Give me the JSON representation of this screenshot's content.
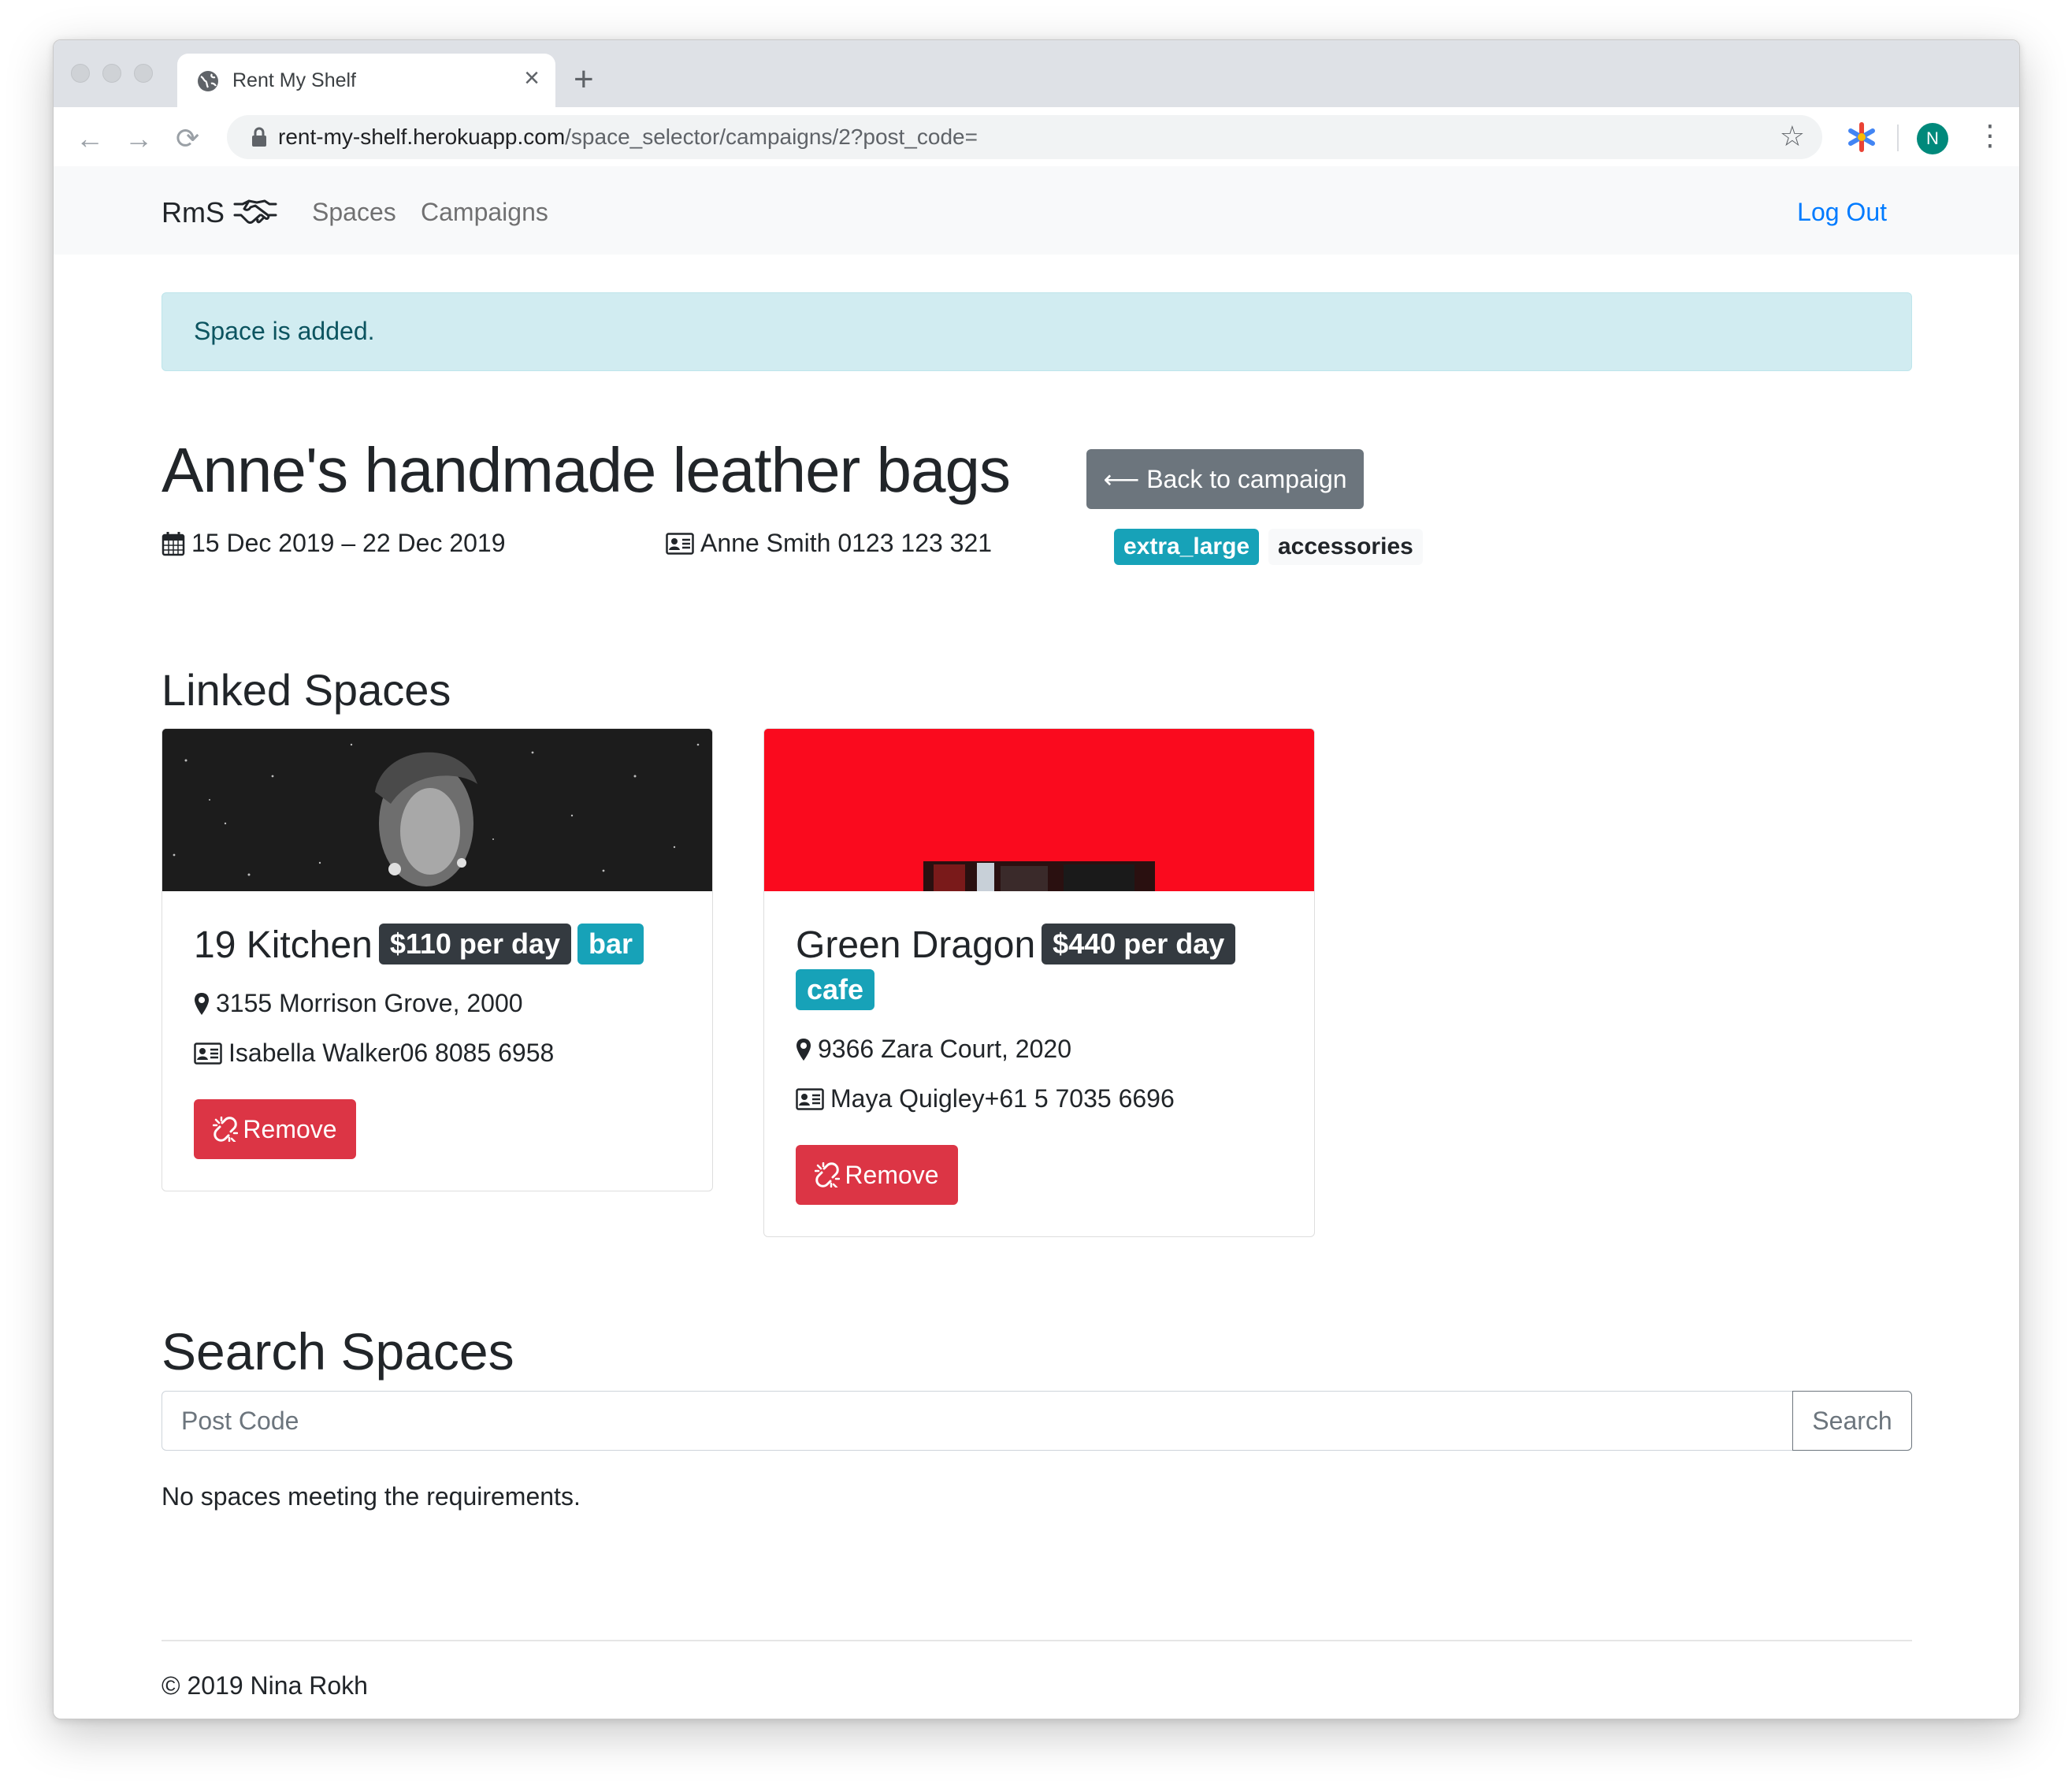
{
  "browser": {
    "tab_title": "Rent My Shelf",
    "tab_close": "×",
    "new_tab": "+",
    "url_host": "rent-my-shelf.herokuapp.com",
    "url_path": "/space_selector/campaigns/2?post_code=",
    "back": "←",
    "forward": "→",
    "reload": "⟳",
    "star": "☆",
    "profile_initial": "N",
    "menu": "⋮"
  },
  "nav": {
    "brand": "RmS",
    "links": [
      "Spaces",
      "Campaigns"
    ],
    "logout": "Log Out"
  },
  "alert": "Space is added.",
  "campaign": {
    "title": "Anne's handmade leather bags",
    "back_button": "⟵ Back to campaign",
    "dates": "15 Dec 2019 – 22 Dec 2019",
    "contact": "Anne Smith 0123 123 321",
    "tags": [
      "extra_large",
      "accessories"
    ]
  },
  "linked_spaces": {
    "heading": "Linked Spaces",
    "cards": [
      {
        "name": "19 Kitchen",
        "price": "$110 per day",
        "type": "bar",
        "address": "3155 Morrison Grove, 2000",
        "contact": "Isabella Walker06 8085 6958",
        "remove_label": "Remove"
      },
      {
        "name": "Green Dragon",
        "price": "$440 per day",
        "type": "cafe",
        "address": "9366 Zara Court, 2020",
        "contact": "Maya Quigley+61 5 7035 6696",
        "remove_label": "Remove"
      }
    ]
  },
  "search": {
    "heading": "Search Spaces",
    "placeholder": "Post Code",
    "button": "Search",
    "empty_message": "No spaces meeting the requirements."
  },
  "footer": "© 2019 Nina Rokh",
  "colors": {
    "primary": "#007bff",
    "info": "#17a2b8",
    "danger": "#dc3545",
    "secondary": "#6c757d",
    "dark": "#343a40"
  }
}
